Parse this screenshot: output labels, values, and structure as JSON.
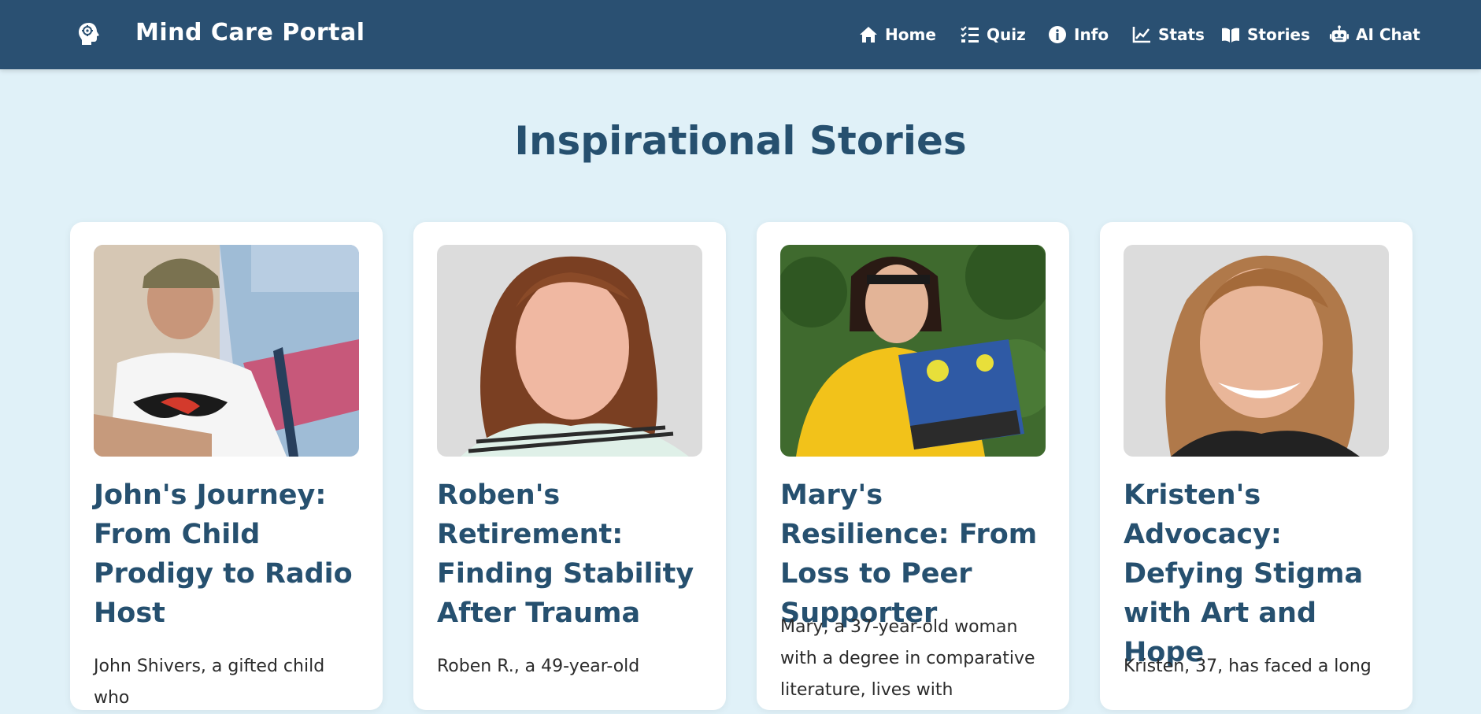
{
  "brand": {
    "title": "Mind Care Portal",
    "logo_icon": "brain-head-icon"
  },
  "nav": [
    {
      "label": "Home",
      "icon": "home-icon"
    },
    {
      "label": "Quiz",
      "icon": "checklist-icon"
    },
    {
      "label": "Info",
      "icon": "info-icon"
    },
    {
      "label": "Stats",
      "icon": "chart-line-icon"
    },
    {
      "label": "Stories",
      "icon": "open-book-icon"
    },
    {
      "label": "AI Chat",
      "icon": "robot-icon"
    }
  ],
  "page": {
    "title": "Inspirational Stories"
  },
  "stories": [
    {
      "title": "John's Journey: From Child Prodigy to Radio Host",
      "excerpt": "John Shivers, a gifted child who",
      "image": "photo of a man in a cap and white t-shirt"
    },
    {
      "title": "Roben's Retirement: Finding Stability After Trauma",
      "excerpt": "Roben R., a 49-year-old",
      "image": "photo of a woman with wavy hair in a striped top"
    },
    {
      "title": "Mary's Resilience: From Loss to Peer Supporter",
      "excerpt": "Mary, a 37-year-old woman with a degree in comparative literature, lives with",
      "image": "photo of a woman in yellow holding a painting"
    },
    {
      "title": "Kristen's Advocacy: Defying Stigma with Art and Hope",
      "excerpt": "Kristen, 37, has faced a long",
      "image": "photo of a smiling woman with shoulder-length hair"
    }
  ],
  "colors": {
    "navbar": "#2a5072",
    "background": "#e0f1f8",
    "heading": "#26506f",
    "card": "#ffffff"
  }
}
